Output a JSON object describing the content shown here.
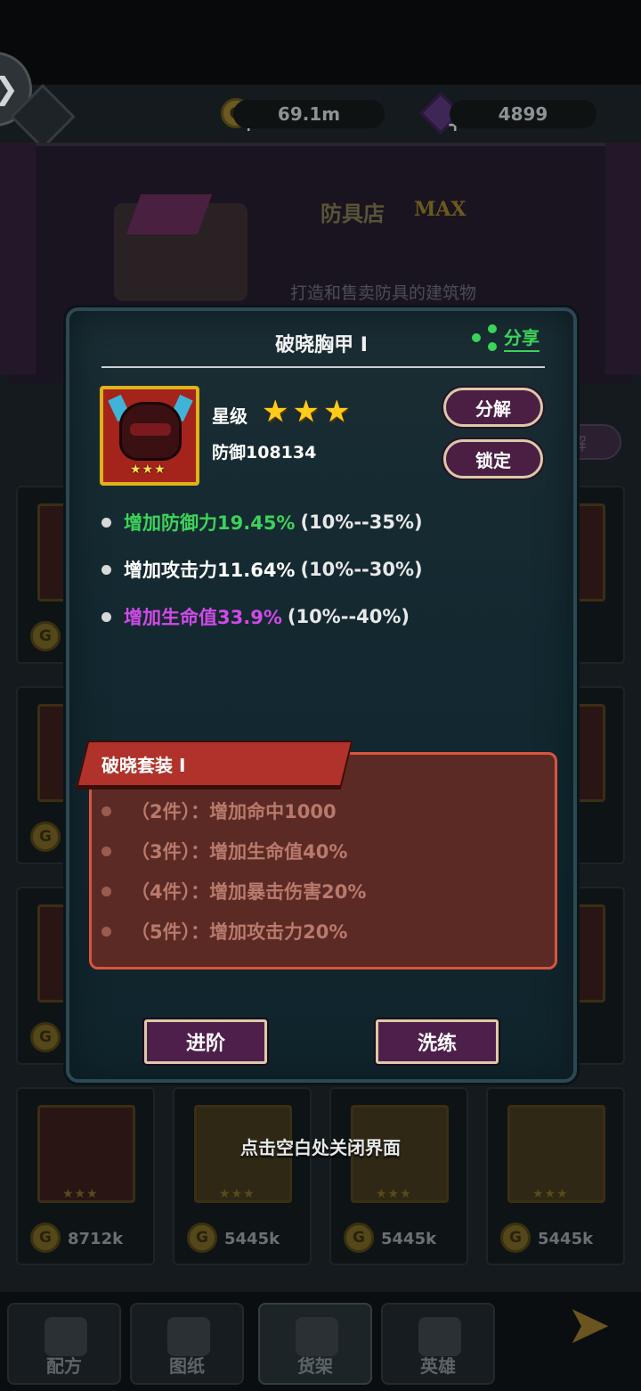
{
  "header": {
    "gold_amount": "69.1m",
    "gem_amount": "4899"
  },
  "shop": {
    "title": "防具店",
    "level": "MAX",
    "description": "打造和售卖防具的建筑物"
  },
  "background_cards": {
    "prices": [
      "8712k",
      "5445k",
      "5445k",
      "5445k"
    ]
  },
  "bottom_nav": {
    "tabs": [
      "配方",
      "图纸",
      "货架",
      "英雄"
    ]
  },
  "item": {
    "name": "破晓胸甲 I",
    "share_label": "分享",
    "star_label": "星级",
    "star_count": 3,
    "defense": "防御108134",
    "decompose_label": "分解",
    "lock_label": "锁定",
    "attributes": [
      {
        "main": "增加防御力19.45%",
        "range": "(10%--35%)",
        "color": "#3bd35a"
      },
      {
        "main": "增加攻击力11.64%",
        "range": "(10%--30%)",
        "color": "#ffffff"
      },
      {
        "main": "增加生命值33.9%",
        "range": "(10%--40%)",
        "color": "#d04ae8"
      }
    ]
  },
  "set": {
    "title": "破晓套装 I",
    "bonuses": [
      "（2件）：增加命中1000",
      "（3件）：增加生命值40%",
      "（4件）：增加暴击伤害20%",
      "（5件）：增加攻击力20%"
    ]
  },
  "actions": {
    "advance_label": "进阶",
    "refine_label": "洗练"
  },
  "close_hint": "点击空白处关闭界面"
}
